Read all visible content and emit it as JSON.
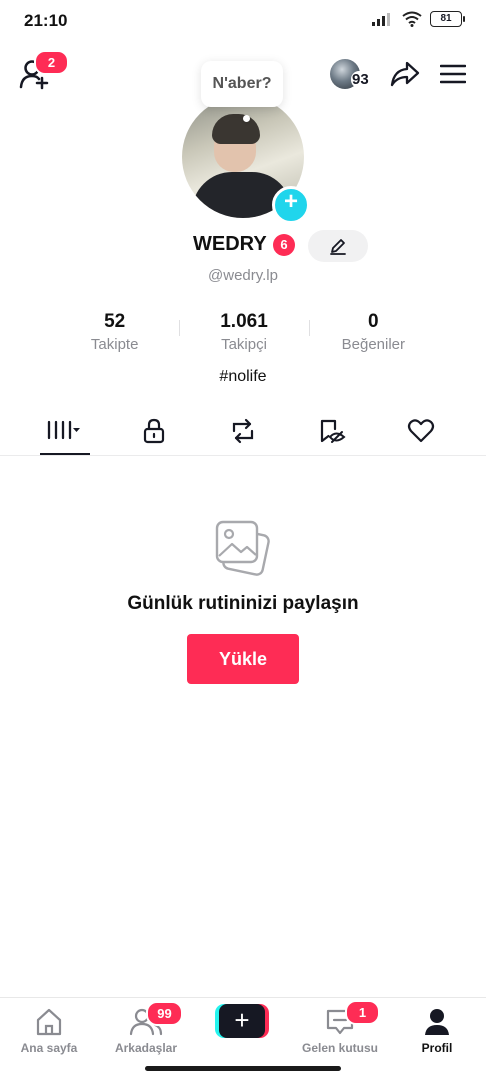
{
  "status_bar": {
    "time": "21:10",
    "battery": "81"
  },
  "header": {
    "add_friend_badge": "2",
    "mini_avatar_count": "93"
  },
  "profile": {
    "status_bubble": "N'aber?",
    "name": "WEDRY",
    "name_badge": "6",
    "handle": "@wedry.lp",
    "stats": [
      {
        "value": "52",
        "label": "Takipte"
      },
      {
        "value": "1.061",
        "label": "Takipçi"
      },
      {
        "value": "0",
        "label": "Beğeniler"
      }
    ],
    "bio": "#nolife"
  },
  "tabs": [
    {
      "icon": "grid-icon",
      "active": true
    },
    {
      "icon": "lock-icon"
    },
    {
      "icon": "repost-icon"
    },
    {
      "icon": "bookmark-hidden-icon"
    },
    {
      "icon": "heart-icon"
    }
  ],
  "empty_state": {
    "icon": "photos-icon",
    "title": "Günlük rutininizi paylaşın",
    "button": "Yükle"
  },
  "bottom_nav": {
    "items": [
      {
        "label": "Ana sayfa",
        "icon": "home-icon"
      },
      {
        "label": "Arkadaşlar",
        "icon": "friends-icon",
        "badge": "99"
      },
      {
        "label": "",
        "icon": "plus-icon"
      },
      {
        "label": "Gelen kutusu",
        "icon": "inbox-icon",
        "badge": "1"
      },
      {
        "label": "Profil",
        "icon": "profile-icon",
        "active": true
      }
    ]
  },
  "colors": {
    "accent": "#fe2c55",
    "cyan": "#20d5ec",
    "text": "#161823",
    "muted": "#8a8b91"
  }
}
